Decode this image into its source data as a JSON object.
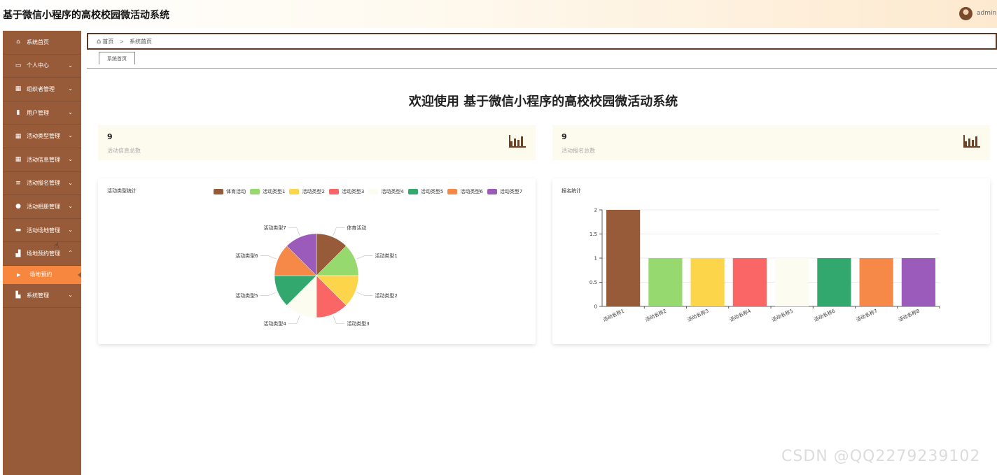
{
  "header": {
    "title": "基于微信小程序的高校校园微活动系统",
    "username": "admin"
  },
  "sidebar": {
    "items": [
      {
        "label": "系统首页",
        "icon": "home-icon",
        "glyph": "⌂",
        "has_children": false
      },
      {
        "label": "个人中心",
        "icon": "id-card-icon",
        "glyph": "▭",
        "has_children": true
      },
      {
        "label": "组织者管理",
        "icon": "grid-icon",
        "glyph": "▦",
        "has_children": true
      },
      {
        "label": "用户管理",
        "icon": "clipboard-icon",
        "glyph": "▮",
        "has_children": true
      },
      {
        "label": "活动类型管理",
        "icon": "grid-icon",
        "glyph": "▦",
        "has_children": true
      },
      {
        "label": "活动信息管理",
        "icon": "grid-icon",
        "glyph": "▦",
        "has_children": true
      },
      {
        "label": "活动报名管理",
        "icon": "list-icon",
        "glyph": "≡",
        "has_children": true
      },
      {
        "label": "活动相册管理",
        "icon": "location-pin-icon",
        "glyph": "●",
        "has_children": true
      },
      {
        "label": "活动场地管理",
        "icon": "monitor-icon",
        "glyph": "▬",
        "has_children": true
      },
      {
        "label": "场地预约管理",
        "icon": "bar-chart-icon",
        "glyph": "▟",
        "has_children": true,
        "expanded": true
      }
    ],
    "submenu": {
      "label": "场地预约"
    },
    "last_item": {
      "label": "系统管理",
      "icon": "thumbs-up-icon",
      "glyph": "▙"
    },
    "chevron_down": "⌄",
    "chevron_up": "⌃"
  },
  "breadcrumb": {
    "home": "首页",
    "separator": ">",
    "current": "系统首页"
  },
  "tabs": [
    {
      "label": "系统首页"
    }
  ],
  "main": {
    "welcome": "欢迎使用 基于微信小程序的高校校园微活动系统",
    "stats": [
      {
        "value": "9",
        "label": "活动信息总数"
      },
      {
        "value": "9",
        "label": "活动报名总数"
      }
    ]
  },
  "colors": {
    "sidebar_bg": "#975b39",
    "submenu_active": "#f7863f",
    "stat_card_bg": "#fdfbee"
  },
  "chart_data": [
    {
      "type": "pie",
      "title": "活动类型统计",
      "categories": [
        "体育活动",
        "活动类型1",
        "活动类型2",
        "活动类型3",
        "活动类型4",
        "活动类型5",
        "活动类型6",
        "活动类型7"
      ],
      "values": [
        1,
        1,
        1,
        1,
        1,
        1,
        1,
        1
      ],
      "colors": [
        "#975b39",
        "#96d96e",
        "#fdd54a",
        "#f96665",
        "#fcfcf0",
        "#32a86f",
        "#f78948",
        "#9b5bba"
      ],
      "legend": "top-right"
    },
    {
      "type": "bar",
      "title": "报名统计",
      "categories": [
        "活动名称1",
        "活动名称2",
        "活动名称3",
        "活动名称4",
        "活动名称5",
        "活动名称6",
        "活动名称7",
        "活动名称8"
      ],
      "values": [
        2,
        1,
        1,
        1,
        1,
        1,
        1,
        1
      ],
      "colors": [
        "#975b39",
        "#96d96e",
        "#fdd54a",
        "#f96665",
        "#fcfcf0",
        "#32a86f",
        "#f78948",
        "#9b5bba"
      ],
      "yticks": [
        "0",
        "0.5",
        "1",
        "1.5",
        "2"
      ],
      "ylim": [
        0,
        2
      ],
      "grid": true
    }
  ],
  "watermark": "CSDN @QQ2279239102"
}
